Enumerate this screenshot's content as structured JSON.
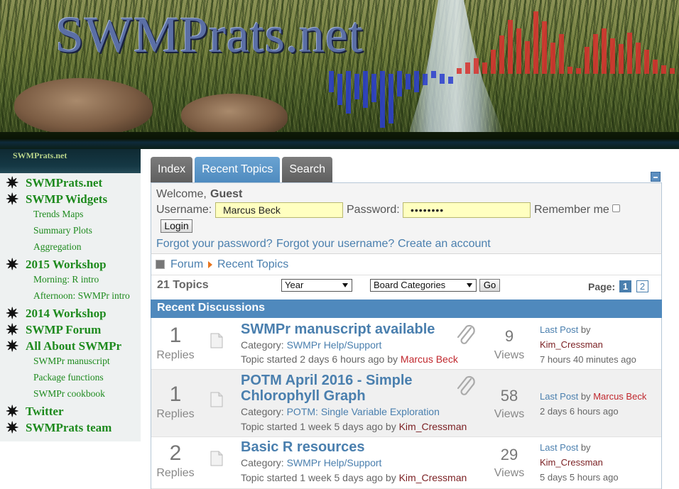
{
  "site": {
    "logo": "SWMPrats.net"
  },
  "sidebar": {
    "title": "SWMPrats.net",
    "items": [
      {
        "label": "SWMPrats.net",
        "level": "main"
      },
      {
        "label": "SWMP Widgets",
        "level": "main"
      },
      {
        "label": "Trends Maps",
        "level": "sub"
      },
      {
        "label": "Summary Plots",
        "level": "sub"
      },
      {
        "label": "Aggregation",
        "level": "sub"
      },
      {
        "label": "2015 Workshop",
        "level": "main"
      },
      {
        "label": "Morning: R intro",
        "level": "sub"
      },
      {
        "label": "Afternoon: SWMPr intro",
        "level": "sub"
      },
      {
        "label": "2014 Workshop",
        "level": "main"
      },
      {
        "label": "SWMP Forum",
        "level": "main"
      },
      {
        "label": "All About SWMPr",
        "level": "main"
      },
      {
        "label": "SWMPr manuscript",
        "level": "sub"
      },
      {
        "label": "Package functions",
        "level": "sub"
      },
      {
        "label": "SWMPr cookbook",
        "level": "sub"
      },
      {
        "label": "Twitter",
        "level": "main"
      },
      {
        "label": "SWMPrats team",
        "level": "main"
      }
    ]
  },
  "forum": {
    "tabs": [
      "Index",
      "Recent Topics",
      "Search"
    ],
    "login": {
      "welcome": "Welcome,",
      "guest": "Guest",
      "username_label": "Username:",
      "username_value": "Marcus Beck",
      "password_label": "Password:",
      "password_value": "••••••••",
      "remember_label": "Remember me",
      "login_button": "Login",
      "forgot_password": "Forgot your password?",
      "forgot_username": "Forgot your username?",
      "create_account": "Create an account"
    },
    "breadcrumb": [
      "Forum",
      "Recent Topics"
    ],
    "topics_count": "21 Topics",
    "time_filter": "Year",
    "category_filter": "Board Categories",
    "go_button": "Go",
    "page_label": "Page:",
    "pages": [
      "1",
      "2"
    ],
    "section_title": "Recent Discussions",
    "topics": [
      {
        "replies": "1",
        "replies_label": "Replies",
        "title_lines": [
          "SWMPr manuscript available"
        ],
        "category_label": "Category:",
        "category": "SWMPr Help/Support",
        "started": "Topic started 2 days 6 hours ago",
        "by": "by",
        "author": "Marcus Beck",
        "views": "9",
        "views_label": "Views",
        "last_post": "Last Post",
        "last_by": "by",
        "last_user": "Kim_Cressman",
        "last_time": "7 hours 40 minutes ago"
      },
      {
        "replies": "1",
        "replies_label": "Replies",
        "title_lines": [
          "POTM April 2016 - Simple",
          "Chlorophyll Graph"
        ],
        "category_label": "Category:",
        "category": "POTM: Single Variable Exploration",
        "started": "Topic started 1 week 5 days ago",
        "by": "by",
        "author": "Kim_Cressman",
        "views": "58",
        "views_label": "Views",
        "last_post": "Last Post",
        "last_by": "by",
        "last_user": "Marcus Beck",
        "last_time": "2 days 6 hours ago"
      },
      {
        "replies": "2",
        "replies_label": "Replies",
        "title_lines": [
          "Basic R resources"
        ],
        "category_label": "Category:",
        "category": "SWMPr Help/Support",
        "started": "Topic started 1 week 5 days ago",
        "by": "by",
        "author": "Kim_Cressman",
        "views": "29",
        "views_label": "Views",
        "last_post": "Last Post",
        "last_by": "by",
        "last_user": "Kim_Cressman",
        "last_time": "5 days 5 hours ago"
      }
    ]
  }
}
